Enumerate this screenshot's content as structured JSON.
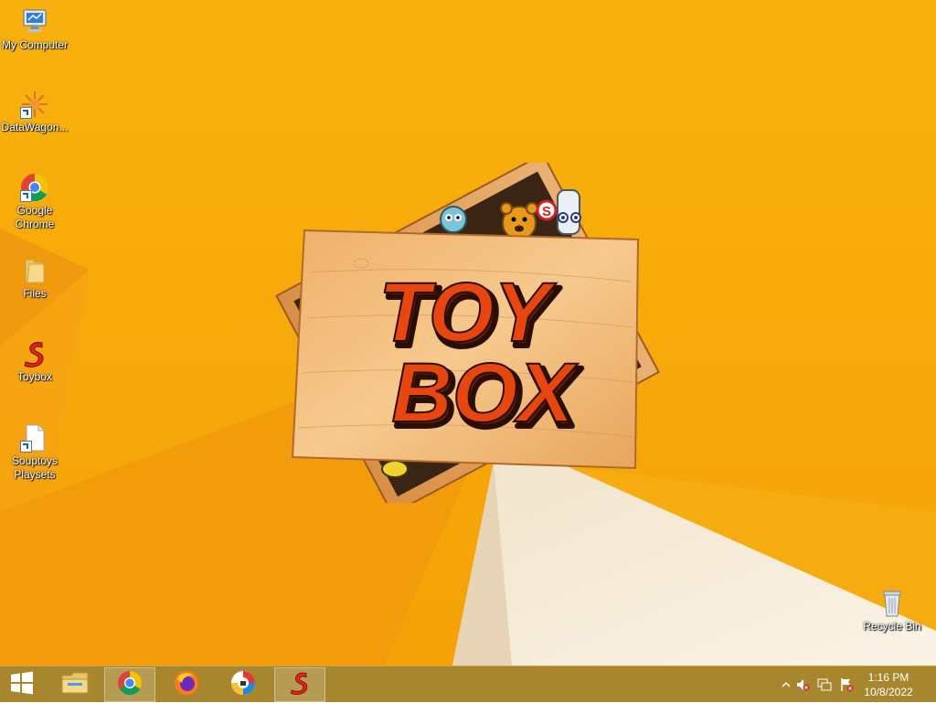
{
  "desktop": {
    "icons": [
      {
        "name": "my-computer",
        "label": "My Computer"
      },
      {
        "name": "datawagon",
        "label": "DataWagon..."
      },
      {
        "name": "google-chrome",
        "label": "Google Chrome"
      },
      {
        "name": "files",
        "label": "Files"
      },
      {
        "name": "toybox",
        "label": "Toybox"
      },
      {
        "name": "souptoys-playsets",
        "label": "Souptoys Playsets"
      },
      {
        "name": "recycle-bin",
        "label": "Recycle Bin"
      }
    ],
    "background_color": "#f7ad0a"
  },
  "splash": {
    "line1": "TOY",
    "line2": "BOX",
    "brand_letter": "S"
  },
  "taskbar": {
    "start_icon": "windows-start-icon",
    "pinned": [
      {
        "name": "file-explorer",
        "icon": "folder-icon"
      },
      {
        "name": "chrome",
        "icon": "chrome-icon",
        "active": true
      },
      {
        "name": "firefox",
        "icon": "firefox-icon"
      },
      {
        "name": "vpn",
        "icon": "lock-app-icon"
      },
      {
        "name": "toybox",
        "icon": "souptoys-icon",
        "active": true
      }
    ],
    "tray": {
      "time": "1:16 PM",
      "date": "10/8/2022"
    }
  },
  "colors": {
    "taskbar": "#a7862d",
    "toy_text": "#e8460f"
  }
}
